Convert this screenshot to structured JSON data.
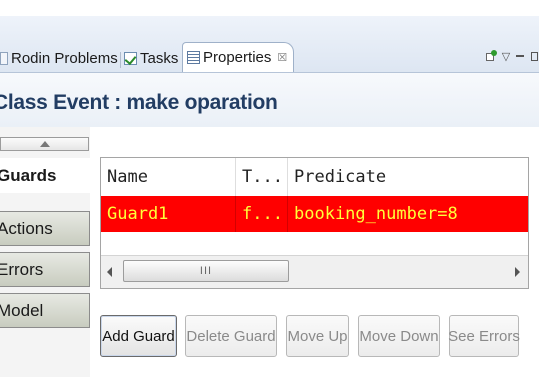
{
  "tabs": [
    {
      "label": "Rodin Problems",
      "icon": "problems-icon",
      "active": false
    },
    {
      "label": "Tasks",
      "icon": "tasks-icon",
      "active": false
    },
    {
      "label": "Properties",
      "icon": "properties-icon",
      "active": true,
      "close_glyph": "☒"
    }
  ],
  "view_toolbar": {
    "pin_icon": "pin-to-selection-icon",
    "menu_glyph": "▽",
    "minimize_icon": "minimize-icon",
    "maximize_icon": "maximize-icon"
  },
  "header": {
    "title": "Class Event :  make oparation"
  },
  "sidebar": {
    "scroll_up_icon": "triangle-up-icon",
    "items": [
      {
        "label": "Guards",
        "active": true
      },
      {
        "label": "Actions",
        "active": false
      },
      {
        "label": "Errors",
        "active": false
      },
      {
        "label": "Model",
        "active": false
      }
    ]
  },
  "table": {
    "columns": [
      "Name",
      "T...",
      "Predicate"
    ],
    "rows": [
      {
        "cells": [
          "Guard1",
          "f...",
          "booking_number=8"
        ],
        "highlight_color": "#ff0000",
        "text_color": "#ffff3a"
      }
    ],
    "scrollbar_grip": "III"
  },
  "buttons": [
    {
      "label": "Add Guard",
      "enabled": true
    },
    {
      "label": "Delete Guard",
      "enabled": false
    },
    {
      "label": "Move Up",
      "enabled": false
    },
    {
      "label": "Move Down",
      "enabled": false
    },
    {
      "label": "See Errors",
      "enabled": false
    }
  ],
  "colors": {
    "title": "#223d63",
    "selection_row": "#ff0000"
  }
}
